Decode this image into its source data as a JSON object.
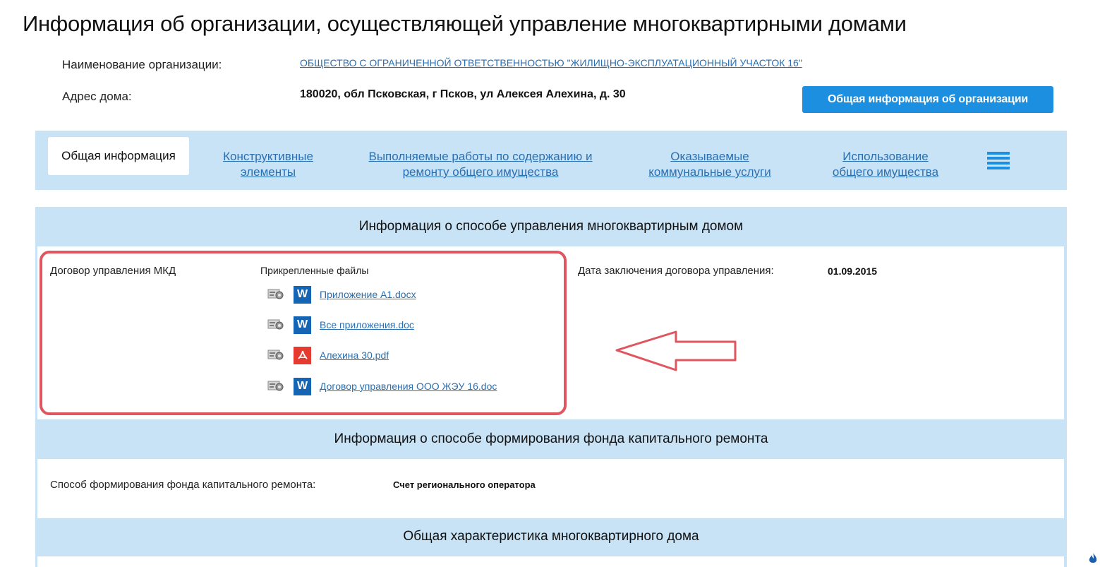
{
  "page": {
    "title": "Информация об организации, осуществляющей управление многоквартирными домами"
  },
  "organization": {
    "name_label": "Наименование организации:",
    "name_link": "ОБЩЕСТВО С ОГРАНИЧЕННОЙ ОТВЕТСТВЕННОСТЬЮ \"ЖИЛИЩНО-ЭКСПЛУАТАЦИОННЫЙ УЧАСТОК 16\"",
    "address_label": "Адрес дома:",
    "address_value": "180020, обл Псковская, г Псков, ул Алексея Алехина, д. 30",
    "info_button": "Общая информация об организации"
  },
  "tabs": {
    "active": "Общая информация",
    "items": [
      {
        "line1": "Конструктивные",
        "line2": "элементы"
      },
      {
        "line1": "Выполняемые работы по содержанию и",
        "line2": "ремонту общего имущества"
      },
      {
        "line1": "Оказываемые",
        "line2": "коммунальные услуги"
      },
      {
        "line1": "Использование",
        "line2": "общего имущества"
      }
    ],
    "menu_icon": "hamburger-menu-icon"
  },
  "management": {
    "header": "Информация о способе управления многоквартирным домом",
    "contract_label": "Договор управления МКД",
    "files_label": "Прикрепленные файлы",
    "files": [
      {
        "name": "Приложение А1.docx",
        "type": "word-icon"
      },
      {
        "name": "Все приложения.doc",
        "type": "word-icon"
      },
      {
        "name": "Алехина 30.pdf",
        "type": "pdf-icon"
      },
      {
        "name": "Договор управления ООО ЖЭУ 16.doc",
        "type": "word-icon"
      }
    ],
    "date_label": "Дата заключения договора управления:",
    "date_value": "01.09.2015"
  },
  "fund": {
    "header": "Информация о способе формирования фонда капитального ремонта",
    "method_label": "Способ формирования фонда капитального ремонта:",
    "method_value": "Счет регионального оператора"
  },
  "characteristics": {
    "header": "Общая характеристика многоквартирного дома"
  },
  "colors": {
    "accent": "#1d8fe0",
    "panel": "#c9e3f6",
    "link": "#2a6fb0",
    "highlight": "#e0565f"
  }
}
